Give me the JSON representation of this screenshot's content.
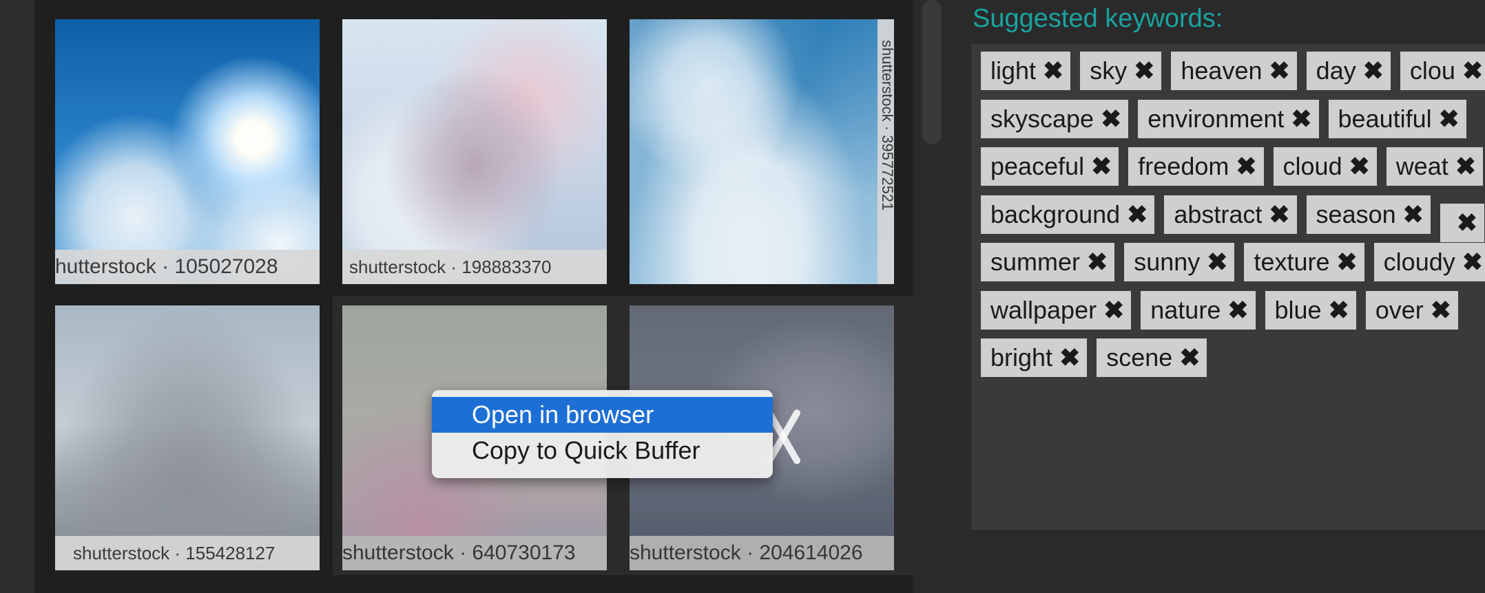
{
  "grid": {
    "tiles": [
      {
        "credit": "hutterstock · 105027028"
      },
      {
        "credit": "shutterstock · 198883370"
      },
      {
        "credit": "shutterstock · 395772521"
      },
      {
        "credit": "shutterstock · 155428127"
      },
      {
        "credit": "shutterstock · 640730173"
      },
      {
        "credit": "shutterstock · 204614026"
      }
    ]
  },
  "context_menu": {
    "items": [
      "Open in browser",
      "Copy to Quick Buffer"
    ],
    "highlighted": "Open in browser"
  },
  "keywords": {
    "title": "Suggested keywords:",
    "rows": [
      [
        "light",
        "sky",
        "heaven",
        "day",
        "clou"
      ],
      [
        "skyscape",
        "environment",
        "beautiful"
      ],
      [
        "peaceful",
        "freedom",
        "cloud",
        "weat"
      ],
      [
        "background",
        "abstract",
        "season",
        ""
      ],
      [
        "summer",
        "sunny",
        "texture",
        "cloudy"
      ],
      [
        "wallpaper",
        "nature",
        "blue",
        "over"
      ],
      [
        "bright",
        "scene"
      ]
    ],
    "remove_icon": "close-icon"
  },
  "colors": {
    "accent_title": "#1aa3a0",
    "menu_highlight": "#1d6fd6",
    "chip_bg": "#cfcfcf"
  }
}
